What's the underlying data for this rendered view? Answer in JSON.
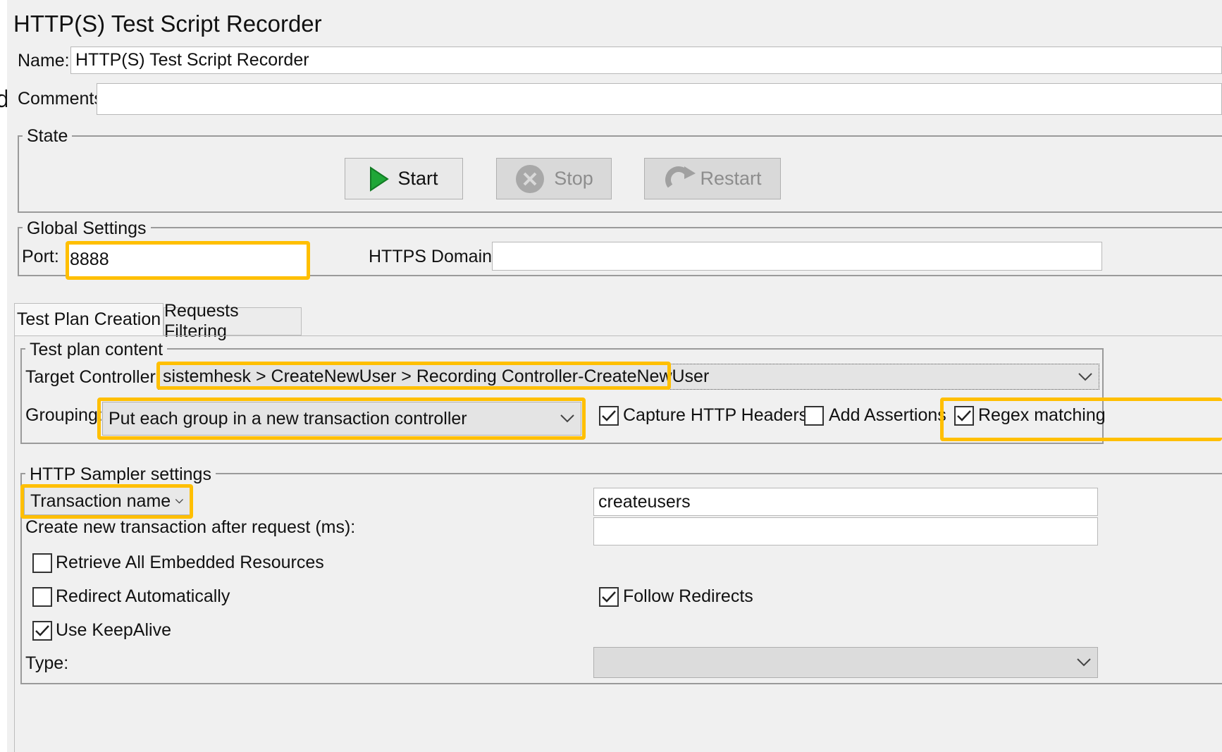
{
  "window": {
    "title": "HTTP(S) Test Script Recorder",
    "edge_text": "d"
  },
  "name_field": {
    "label": "Name:",
    "value": "HTTP(S) Test Script Recorder"
  },
  "comments_field": {
    "label": "Comments:",
    "value": ""
  },
  "state": {
    "legend": "State",
    "buttons": {
      "start": "Start",
      "stop": "Stop",
      "restart": "Restart"
    }
  },
  "global_settings": {
    "legend": "Global Settings",
    "port_label": "Port:",
    "port_value": "8888",
    "https_domains_label": "HTTPS Domains:",
    "https_domains_value": ""
  },
  "tabs": [
    {
      "label": "Test Plan Creation",
      "selected": true
    },
    {
      "label": "Requests Filtering",
      "selected": false
    }
  ],
  "test_plan_content": {
    "legend": "Test plan content",
    "target_controller_label": "Target Controller:",
    "target_controller_value": "sistemhesk > CreateNewUser > Recording Controller-CreateNewUser",
    "grouping_label": "Grouping:",
    "grouping_value": "Put each group in a new transaction controller",
    "checkboxes": [
      {
        "label": "Capture HTTP Headers",
        "checked": true
      },
      {
        "label": "Add Assertions",
        "checked": false
      },
      {
        "label": "Regex matching",
        "checked": true
      }
    ]
  },
  "http_sampler_settings": {
    "legend": "HTTP Sampler settings",
    "transaction_name_label": "Transaction name",
    "transaction_name_value": "createusers",
    "create_new_transaction_label": "Create new transaction after request (ms):",
    "create_new_transaction_value": "",
    "retrieve_embedded": {
      "label": "Retrieve All Embedded Resources",
      "checked": false
    },
    "redirect_automatically": {
      "label": "Redirect Automatically",
      "checked": false
    },
    "follow_redirects": {
      "label": "Follow Redirects",
      "checked": true
    },
    "use_keepalive": {
      "label": "Use KeepAlive",
      "checked": true
    },
    "type_label": "Type:",
    "type_value": ""
  },
  "colors": {
    "highlight": "#ffbf00",
    "panel": "#f0f0f0",
    "start_green": "#1fa637"
  }
}
